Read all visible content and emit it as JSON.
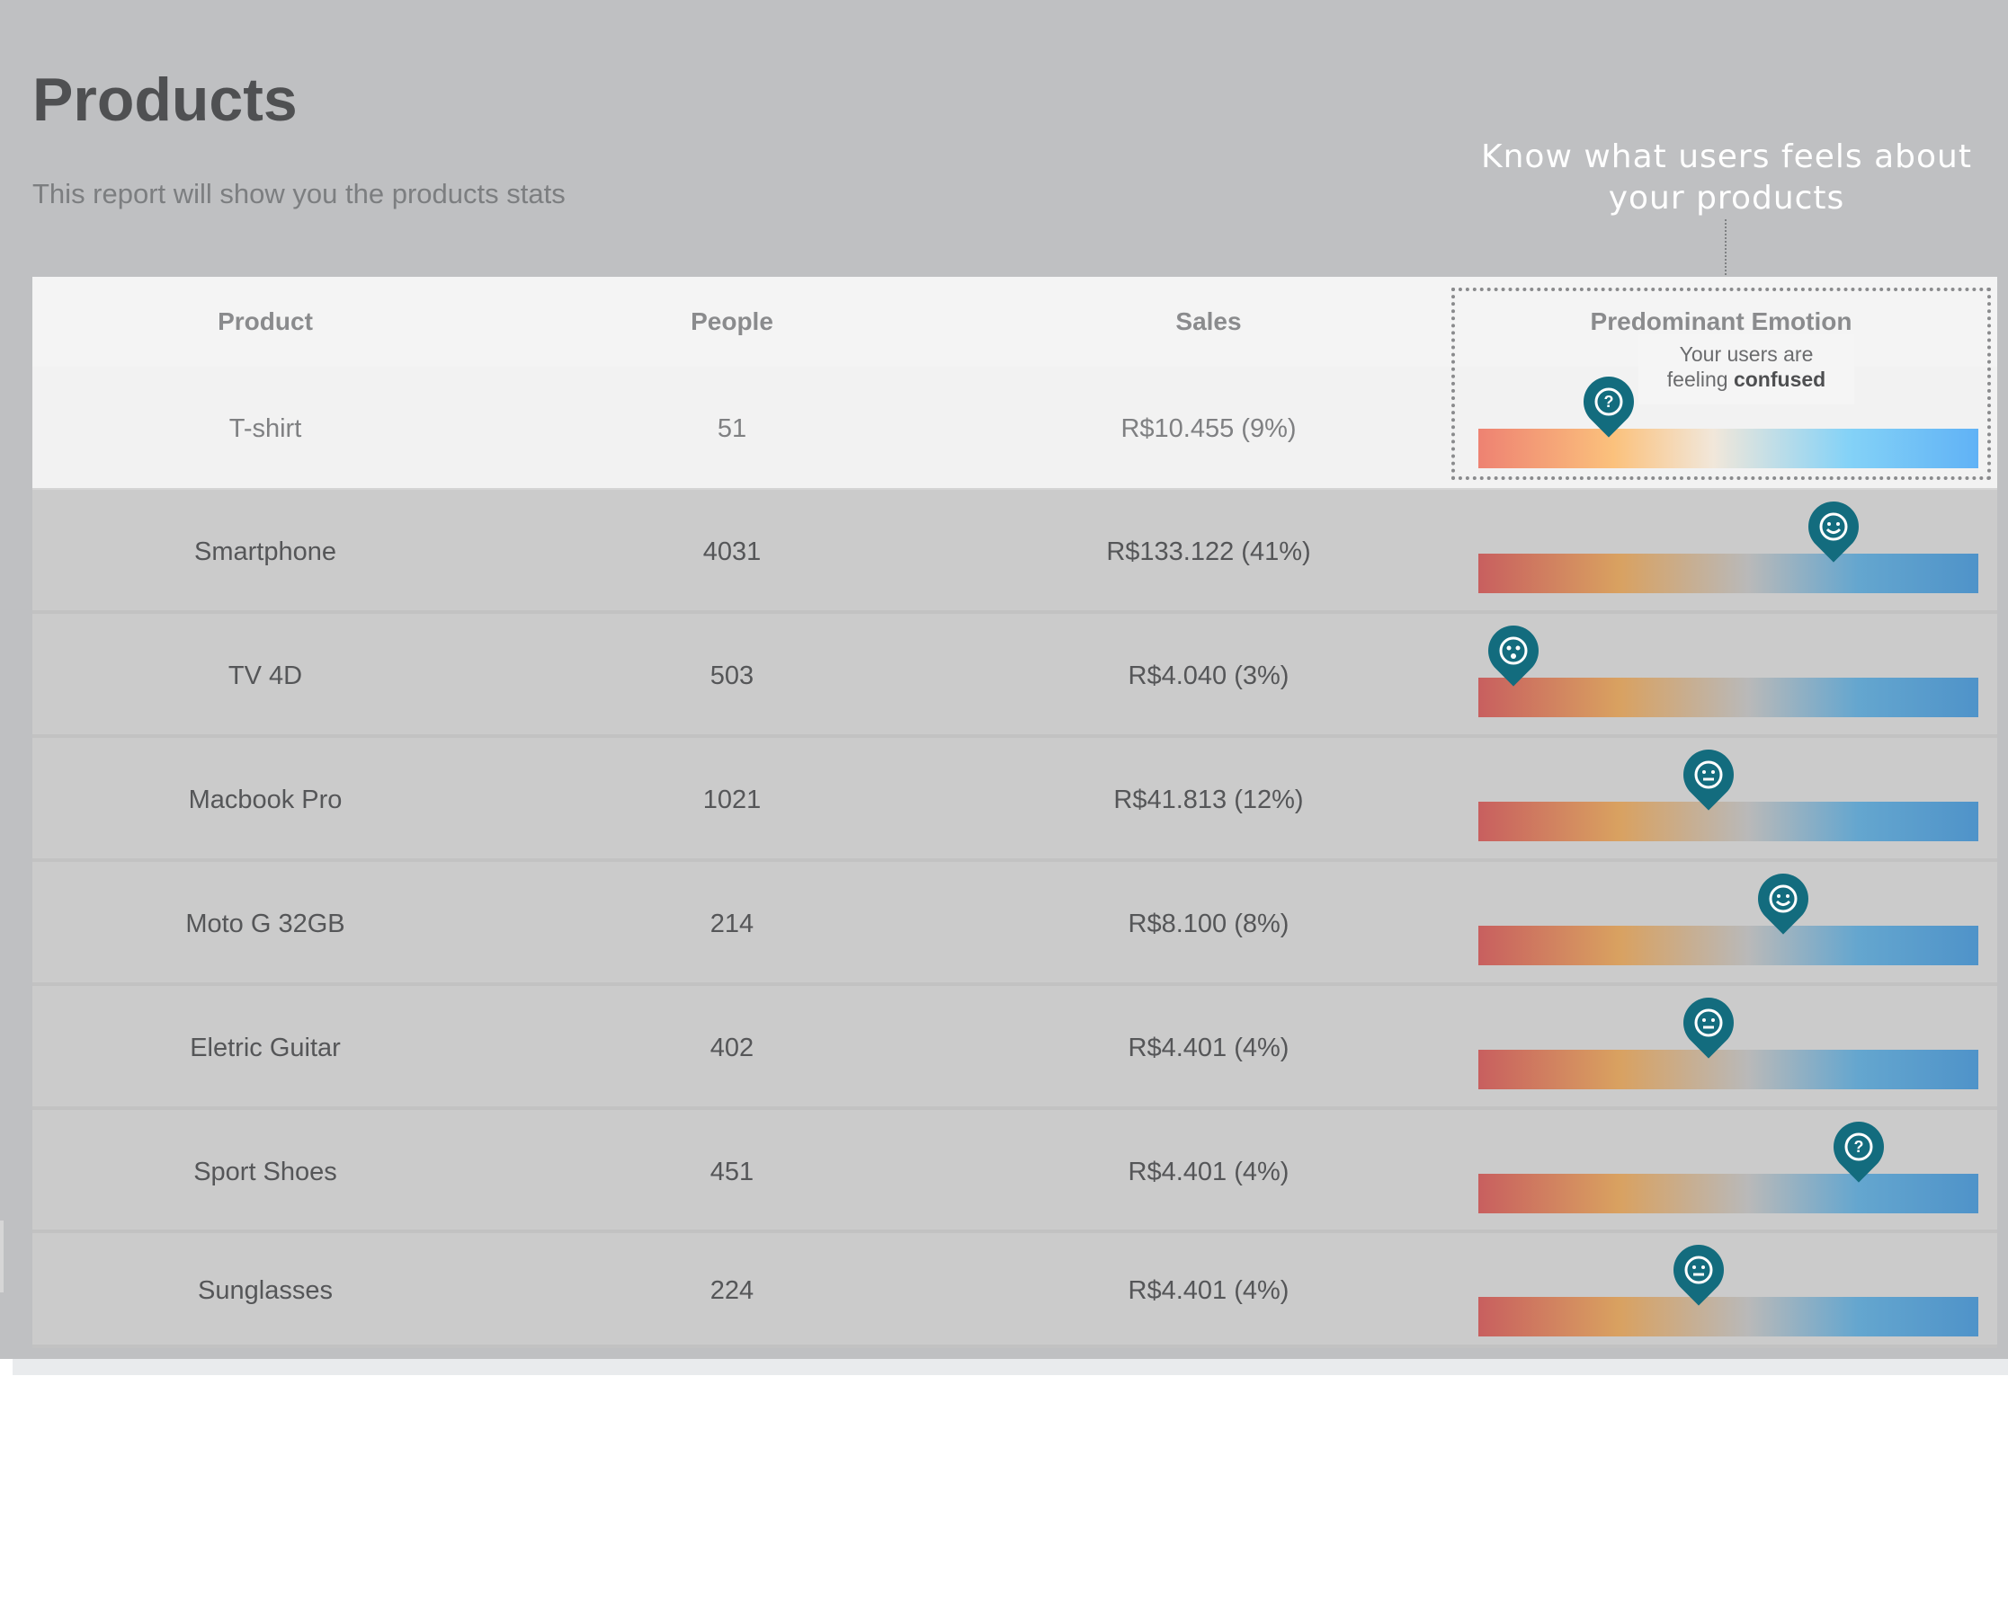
{
  "header": {
    "title": "Products",
    "subtitle": "This report will show you the products stats"
  },
  "callout": {
    "line1": "Know what users feels about",
    "line2": "your products"
  },
  "table": {
    "columns": [
      "Product",
      "People",
      "Sales",
      "Predominant Emotion"
    ],
    "tooltip": {
      "prefix": "Your users are",
      "prefix2": "feeling",
      "emotion": "confused"
    },
    "rows": [
      {
        "product": "T-shirt",
        "people": "51",
        "sales": "R$10.455 (9%)",
        "emotion": "confused",
        "icon": "question-icon",
        "level": 0.26
      },
      {
        "product": "Smartphone",
        "people": "4031",
        "sales": "R$133.122 (41%)",
        "emotion": "happy",
        "icon": "happy-face-icon",
        "level": 0.71
      },
      {
        "product": "TV 4D",
        "people": "503",
        "sales": "R$4.040 (3%)",
        "emotion": "surprised",
        "icon": "surprised-face-icon",
        "level": 0.07
      },
      {
        "product": "Macbook Pro",
        "people": "1021",
        "sales": "R$41.813 (12%)",
        "emotion": "neutral",
        "icon": "neutral-face-icon",
        "level": 0.46
      },
      {
        "product": "Moto G 32GB",
        "people": "214",
        "sales": "R$8.100 (8%)",
        "emotion": "happy",
        "icon": "happy-face-icon",
        "level": 0.61
      },
      {
        "product": "Eletric Guitar",
        "people": "402",
        "sales": "R$4.401 (4%)",
        "emotion": "neutral",
        "icon": "neutral-face-icon",
        "level": 0.46
      },
      {
        "product": "Sport Shoes",
        "people": "451",
        "sales": "R$4.401 (4%)",
        "emotion": "confused",
        "icon": "question-icon",
        "level": 0.76
      },
      {
        "product": "Sunglasses",
        "people": "224",
        "sales": "R$4.401 (4%)",
        "emotion": "neutral",
        "icon": "neutral-face-icon",
        "level": 0.44
      }
    ]
  },
  "colors": {
    "pin": "#136c7e",
    "overlay": "#bfc0c2"
  }
}
